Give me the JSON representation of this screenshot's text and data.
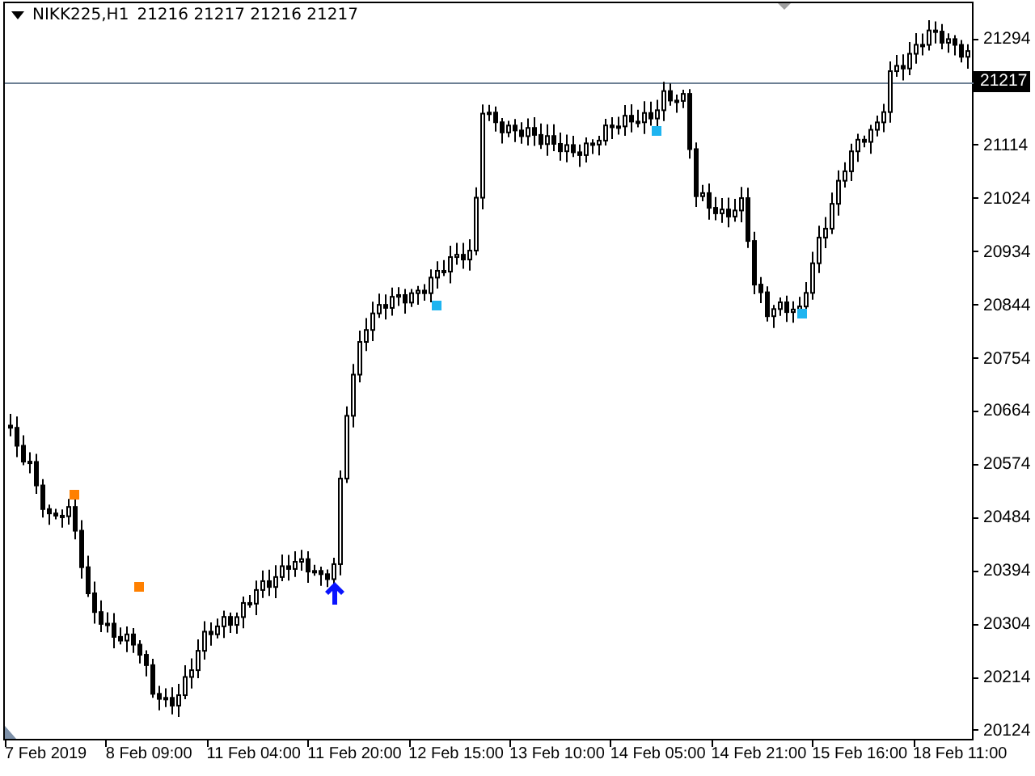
{
  "chart": {
    "symbol": "NIKK225,H1",
    "quote": "21216 21217 21216 21217"
  },
  "price_axis": {
    "labels": [
      "21294",
      "21114",
      "21024",
      "20934",
      "20844",
      "20754",
      "20664",
      "20574",
      "20484",
      "20394",
      "20304",
      "20214",
      "20124"
    ],
    "current_price": "21217"
  },
  "time_axis": {
    "labels": [
      "7 Feb 2019",
      "8 Feb 09:00",
      "11 Feb 04:00",
      "11 Feb 20:00",
      "12 Feb 15:00",
      "13 Feb 10:00",
      "14 Feb 05:00",
      "14 Feb 21:00",
      "15 Feb 16:00",
      "18 Feb 11:00"
    ]
  }
}
